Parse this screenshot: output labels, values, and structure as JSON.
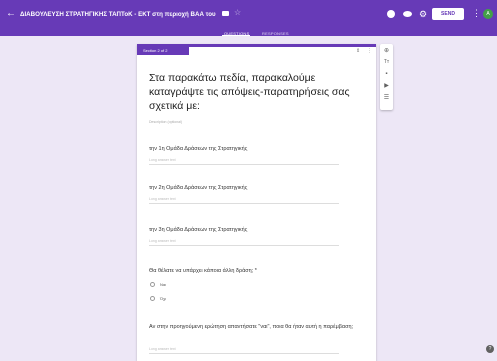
{
  "header": {
    "title": "ΔΙΑΒΟΥΛΕΥΣΗ ΣΤΡΑΤΗΓΙΚΗΣ ΤΑΠΤοΚ - ΕΚΤ στη περιοχή ΒΑΑ του",
    "send_label": "SEND",
    "avatar_letter": "A",
    "tabs": [
      "QUESTIONS",
      "RESPONSES"
    ]
  },
  "section": {
    "badge": "Section 2 of 2",
    "title": "Στα παρακάτω πεδία, παρακαλούμε καταγράψτε τις απόψεις-παρατηρήσεις σας σχετικά με:",
    "description_placeholder": "Description (optional)"
  },
  "questions": [
    {
      "title": "την 1η Ομάδα Δράσεων της Στρατηγικής",
      "answer_placeholder": "Long answer text"
    },
    {
      "title": "την 2η Ομάδα Δράσεων της Στρατηγικής",
      "answer_placeholder": "Long answer text"
    },
    {
      "title": "την 3η Ομάδα Δράσεων της Στρατηγικής",
      "answer_placeholder": "Long answer text"
    },
    {
      "title": "Θα θέλατε να υπάρχει κάποια άλλη δράση; *",
      "options": [
        "Ναι",
        "Όχι"
      ]
    },
    {
      "title": "Αν στην προηγούμενη ερώτηση απαντήσατε \"ναι\", ποια θα ήταν αυτή η παρέμβαση;",
      "answer_placeholder": "Long answer text"
    }
  ],
  "colors": {
    "accent": "#673ab7",
    "background": "#ede7f6"
  },
  "icons": [
    "back-icon",
    "folder-icon",
    "star-icon",
    "palette-icon",
    "eye-icon",
    "gear-icon",
    "more-icon",
    "add-question-icon",
    "title-icon",
    "image-icon",
    "video-icon",
    "section-icon",
    "help-icon"
  ]
}
